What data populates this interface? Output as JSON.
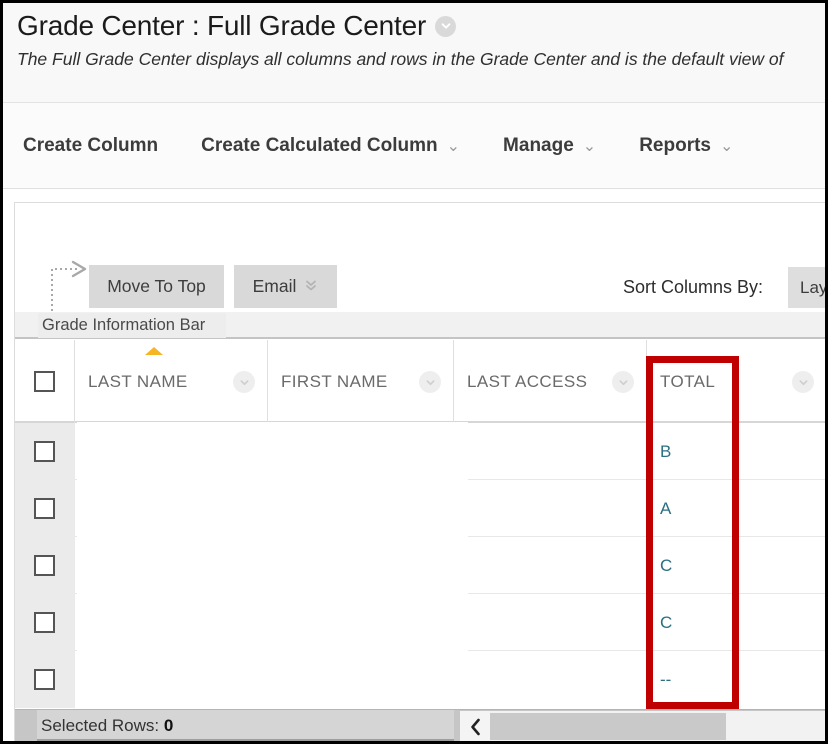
{
  "header": {
    "title": "Grade Center : Full Grade Center",
    "title_menu_icon": "chevron-down-circle-icon",
    "subtitle": "The Full Grade Center displays all columns and rows in the Grade Center and is the default view of"
  },
  "action_bar": {
    "items": [
      {
        "label": "Create Column",
        "caret": ""
      },
      {
        "label": "Create Calculated Column",
        "caret": "⌄"
      },
      {
        "label": "Manage",
        "caret": "⌄"
      },
      {
        "label": "Reports",
        "caret": "⌄"
      }
    ]
  },
  "toolbar": {
    "move_to_top_label": "Move To Top",
    "email_label": "Email",
    "email_caret_icon": "double-chevron-down-icon",
    "branch_arrow_icon": "dotted-branch-arrow-icon",
    "sort_columns_label": "Sort Columns By:",
    "sort_columns_value": "Layout Position"
  },
  "grade_info_bar": {
    "label": "Grade Information Bar"
  },
  "table": {
    "select_all_icon": "checkbox-unchecked-icon",
    "columns": [
      {
        "label": "LAST NAME",
        "sorted": true,
        "sort_icon": "sort-ascending-triangle-icon",
        "menu_icon": "chevron-down-circle-icon"
      },
      {
        "label": "FIRST NAME",
        "sorted": false,
        "menu_icon": "chevron-down-circle-icon"
      },
      {
        "label": "LAST ACCESS",
        "sorted": false,
        "menu_icon": "chevron-down-circle-icon"
      },
      {
        "label": "TOTAL",
        "sorted": false,
        "menu_icon": "chevron-down-circle-icon"
      }
    ],
    "rows": [
      {
        "checkbox_icon": "checkbox-unchecked-icon",
        "last_name": "",
        "first_name": "",
        "last_access": "",
        "total": "B"
      },
      {
        "checkbox_icon": "checkbox-unchecked-icon",
        "last_name": "",
        "first_name": "",
        "last_access": "",
        "total": "A"
      },
      {
        "checkbox_icon": "checkbox-unchecked-icon",
        "last_name": "",
        "first_name": "",
        "last_access": "",
        "total": "C"
      },
      {
        "checkbox_icon": "checkbox-unchecked-icon",
        "last_name": "",
        "first_name": "",
        "last_access": "",
        "total": "C"
      },
      {
        "checkbox_icon": "checkbox-unchecked-icon",
        "last_name": "",
        "first_name": "",
        "last_access": "",
        "total": "--"
      }
    ]
  },
  "footer": {
    "selected_rows_label": "Selected Rows:",
    "selected_rows_count": "0",
    "scroll_left_icon": "chevron-left-icon"
  },
  "annotation": {
    "target_column": "TOTAL",
    "color": "#c00000"
  },
  "colors": {
    "grade_text": "#2b6f82",
    "sort_arrow": "#f5b525",
    "annotation_red": "#c00000",
    "button_gray": "#d9d9d9"
  }
}
